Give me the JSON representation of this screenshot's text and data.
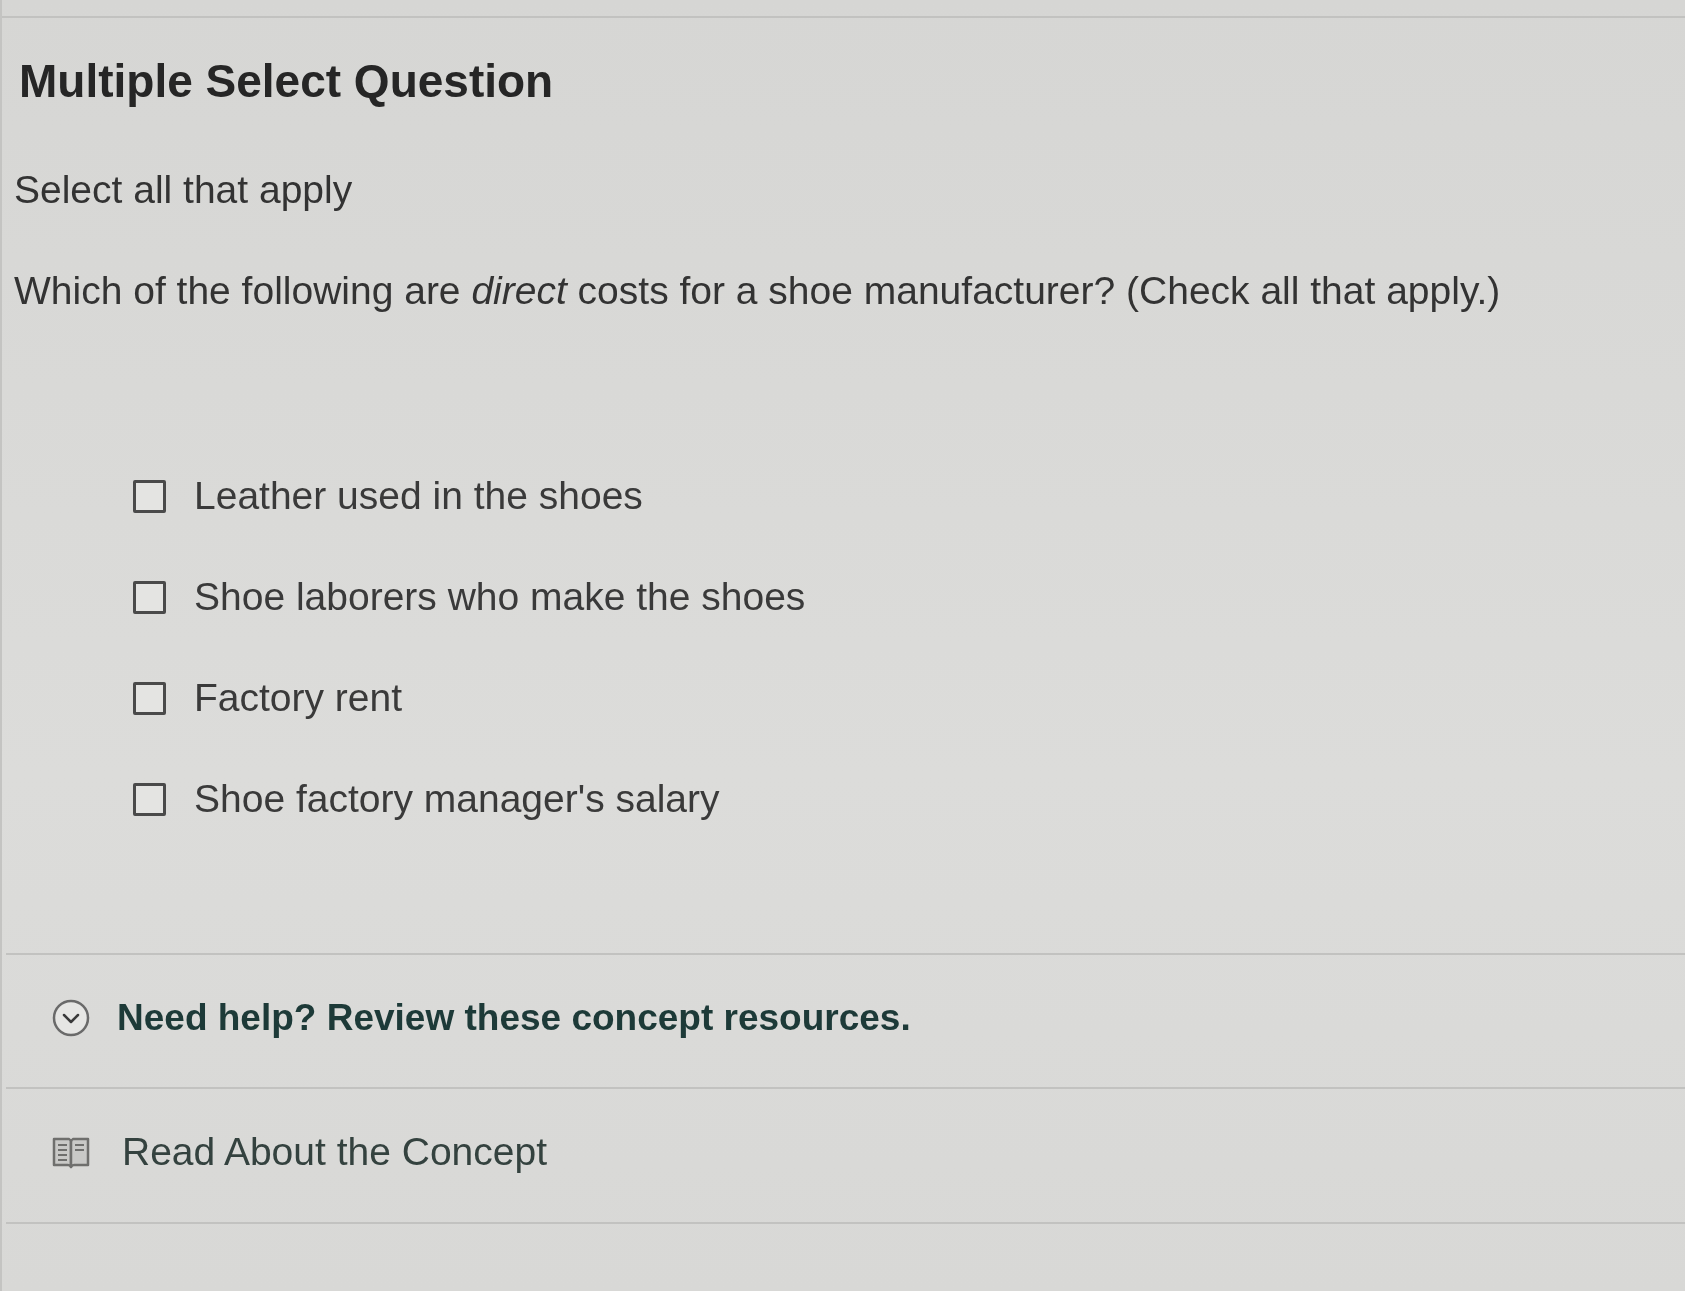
{
  "title": "Multiple Select Question",
  "instruction": "Select all that apply",
  "question": "Which of the following are *direct* costs for a shoe manufacturer? (Check all that apply.)",
  "options": [
    {
      "label": "Leather used in the shoes",
      "checked": false
    },
    {
      "label": "Shoe laborers who make the shoes",
      "checked": false
    },
    {
      "label": "Factory rent",
      "checked": false
    },
    {
      "label": "Shoe factory manager's salary",
      "checked": false
    }
  ],
  "help": {
    "label": "Need help? Review these concept resources.",
    "expanded": true
  },
  "resources": [
    {
      "label": "Read About the Concept"
    }
  ]
}
